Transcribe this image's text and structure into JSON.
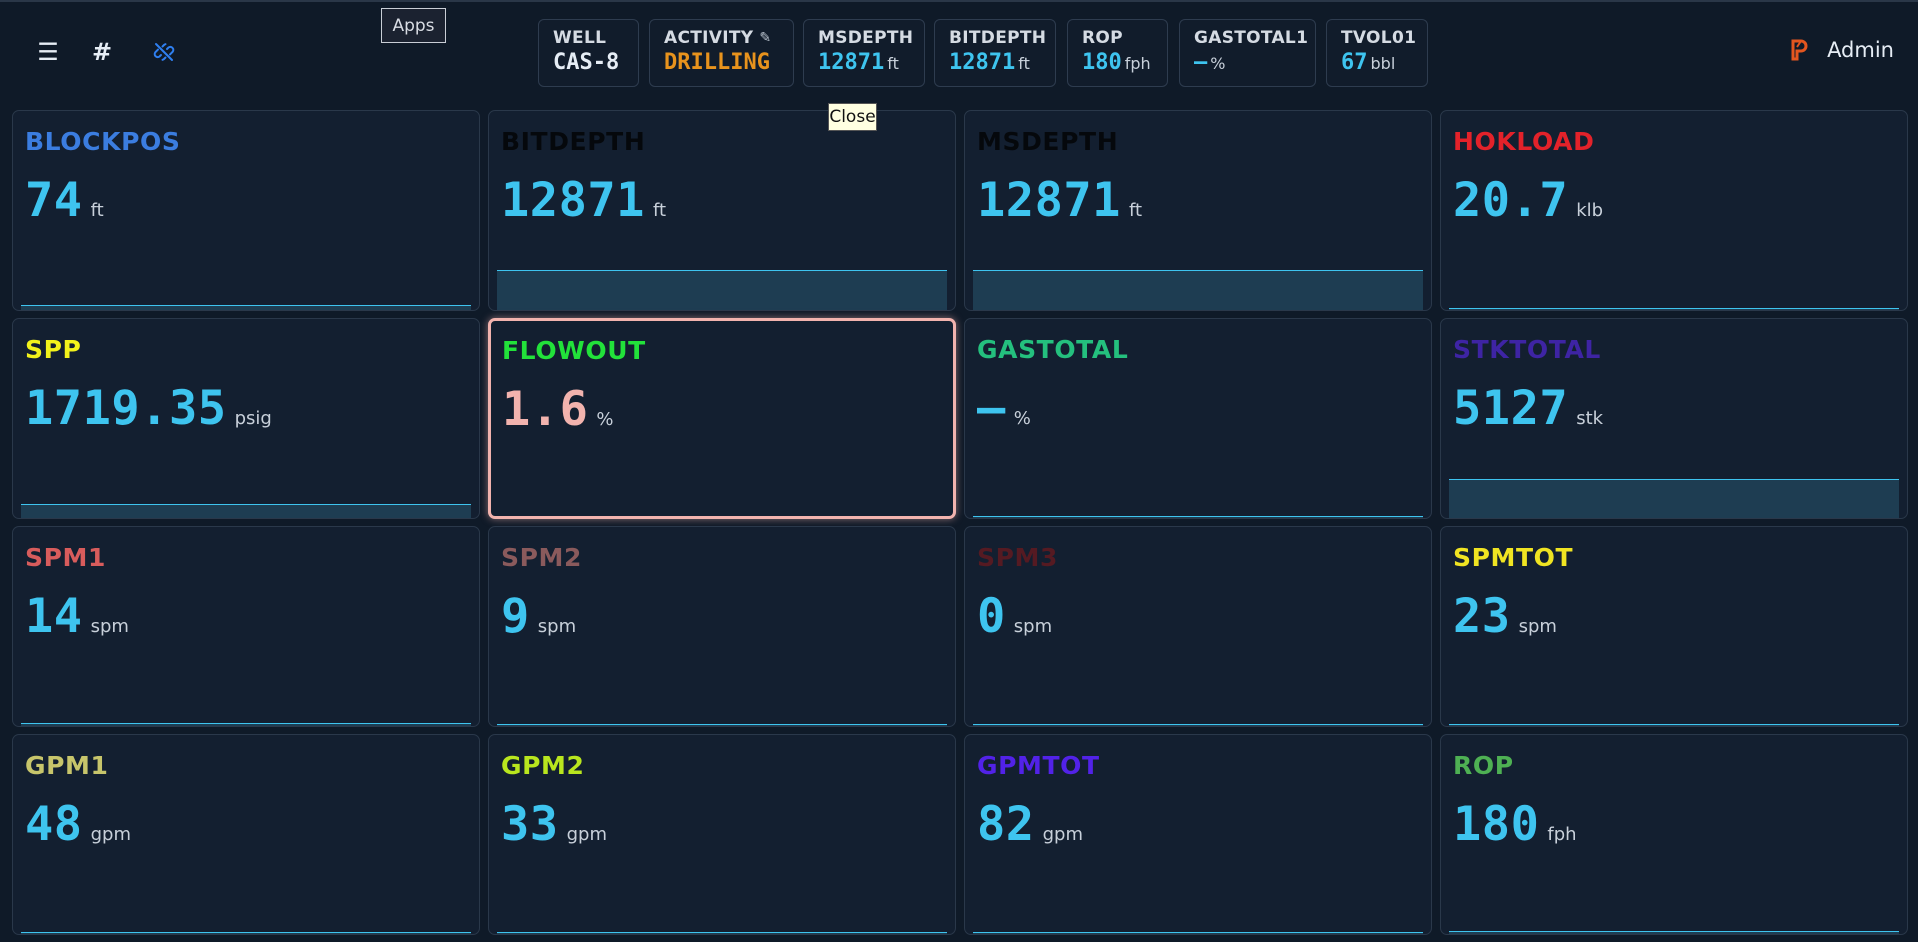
{
  "tooltips": {
    "apps": "Apps",
    "close": "Close"
  },
  "header": {
    "chips": [
      {
        "label": "WELL",
        "value": "CAS-8",
        "unit": "",
        "color": "white"
      },
      {
        "label": "ACTIVITY",
        "value": "DRILLING",
        "unit": "",
        "color": "orange",
        "icon": "pencil-icon"
      },
      {
        "label": "MSDEPTH",
        "value": "12871",
        "unit": "ft",
        "color": "cyan"
      },
      {
        "label": "BITDEPTH",
        "value": "12871",
        "unit": "ft",
        "color": "cyan"
      },
      {
        "label": "ROP",
        "value": "180",
        "unit": "fph",
        "color": "cyan"
      },
      {
        "label": "GASTOTAL1",
        "value": "–",
        "unit": "%",
        "color": "cyan"
      },
      {
        "label": "TVOL01",
        "value": "67",
        "unit": "bbl",
        "color": "cyan"
      }
    ],
    "user": "Admin",
    "icons": [
      "menu-icon",
      "hash-icon",
      "link-off-icon",
      "logo-icon"
    ]
  },
  "tiles": [
    {
      "name": "BLOCKPOS",
      "value": "74",
      "unit": "ft",
      "name_color": "#3b7de0",
      "level": 0.1
    },
    {
      "name": "BITDEPTH",
      "value": "12871",
      "unit": "ft",
      "name_color": "#05080c",
      "level": 0.8
    },
    {
      "name": "MSDEPTH",
      "value": "12871",
      "unit": "ft",
      "name_color": "#05080c",
      "level": 0.8
    },
    {
      "name": "HOKLOAD",
      "value": "20.7",
      "unit": "klb",
      "name_color": "#e3222a",
      "level": 0.03
    },
    {
      "name": "SPP",
      "value": "1719.35",
      "unit": "psig",
      "name_color": "#f2f21b",
      "level": 0.28
    },
    {
      "name": "FLOWOUT",
      "value": "1.6",
      "unit": "%",
      "name_color": "#22e23a",
      "level": 0,
      "selected": true,
      "value_color": "#f2b3ae"
    },
    {
      "name": "GASTOTAL",
      "value": "–",
      "unit": "%",
      "name_color": "#24c07e",
      "level": 0
    },
    {
      "name": "STKTOTAL",
      "value": "5127",
      "unit": "stk",
      "name_color": "#3e24a4",
      "level": 0.78
    },
    {
      "name": "SPM1",
      "value": "14",
      "unit": "spm",
      "name_color": "#d85c5c",
      "level": 0.05
    },
    {
      "name": "SPM2",
      "value": "9",
      "unit": "spm",
      "name_color": "#8a5a5c",
      "level": 0.03
    },
    {
      "name": "SPM3",
      "value": "0",
      "unit": "spm",
      "name_color": "#551a22",
      "level": 0.0
    },
    {
      "name": "SPMTOT",
      "value": "23",
      "unit": "spm",
      "name_color": "#f0e422",
      "level": 0.03
    },
    {
      "name": "GPM1",
      "value": "48",
      "unit": "gpm",
      "name_color": "#c7c56b",
      "level": 0.03
    },
    {
      "name": "GPM2",
      "value": "33",
      "unit": "gpm",
      "name_color": "#b9e61e",
      "level": 0.02
    },
    {
      "name": "GPMTOT",
      "value": "82",
      "unit": "gpm",
      "name_color": "#5222e8",
      "level": 0.03
    },
    {
      "name": "ROP",
      "value": "180",
      "unit": "fph",
      "name_color": "#4eb053",
      "level": 0.05
    }
  ]
}
